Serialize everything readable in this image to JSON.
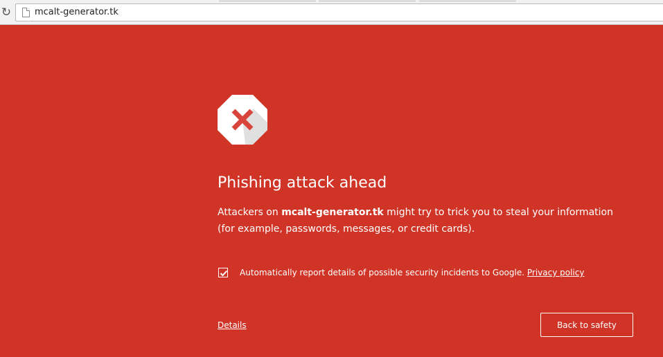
{
  "browser": {
    "url": "mcalt-generator.tk",
    "reload_icon": "reload-icon",
    "page_icon": "page-icon"
  },
  "warning": {
    "icon": "error-stop-icon",
    "title": "Phishing attack ahead",
    "description_before": "Attackers on ",
    "domain": "mcalt-generator.tk",
    "description_after": " might try to trick you to steal your information (for example, passwords, messages, or credit cards).",
    "report_checked": true,
    "report_text": "Automatically report details of possible security incidents to Google.",
    "privacy_link": "Privacy policy",
    "details_link": "Details",
    "back_button": "Back to safety"
  },
  "colors": {
    "background": "#cf3426",
    "text": "#ffffff",
    "icon_x": "#d9453b"
  }
}
